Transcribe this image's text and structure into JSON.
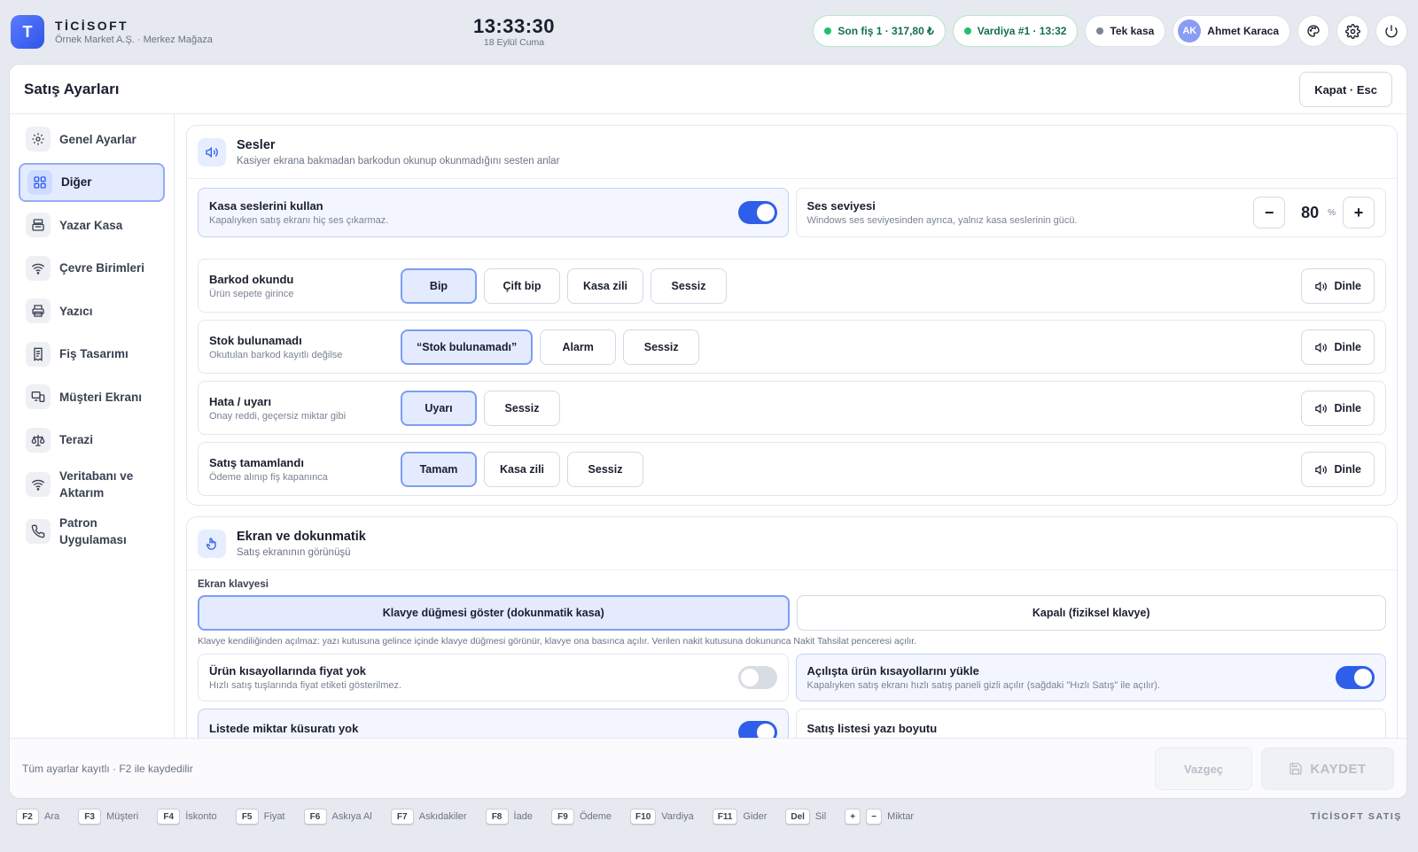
{
  "app": {
    "name": "TİCİSOFT",
    "company": "Örnek Market A.Ş. · Merkez Mağaza",
    "logo_letter": "T"
  },
  "clock": {
    "time": "13:33:30",
    "date": "18 Eylül Cuma"
  },
  "status": {
    "last_receipt": "Son fiş 1 · 317,80 ₺",
    "shift": "Vardiya #1 · 13:32",
    "register": "Tek kasa"
  },
  "user": {
    "initials": "AK",
    "name": "Ahmet Karaca"
  },
  "modal": {
    "title": "Satış Ayarları",
    "close_label": "Kapat · Esc"
  },
  "sidebar": {
    "items": [
      {
        "label": "Genel Ayarlar",
        "icon": "gear-icon"
      },
      {
        "label": "Diğer",
        "icon": "grid-icon",
        "active": true
      },
      {
        "label": "Yazar Kasa",
        "icon": "cash-register-icon"
      },
      {
        "label": "Çevre Birimleri",
        "icon": "wifi-icon"
      },
      {
        "label": "Yazıcı",
        "icon": "printer-icon"
      },
      {
        "label": "Fiş Tasarımı",
        "icon": "receipt-icon"
      },
      {
        "label": "Müşteri Ekranı",
        "icon": "monitor-icon"
      },
      {
        "label": "Terazi",
        "icon": "scale-icon"
      },
      {
        "label": "Veritabanı ve Aktarım",
        "icon": "wifi-icon"
      },
      {
        "label": "Patron Uygulaması",
        "icon": "phone-icon"
      }
    ]
  },
  "sounds": {
    "title": "Sesler",
    "subtitle": "Kasiyer ekrana bakmadan barkodun okunup okunmadığını sesten anlar",
    "use_sounds": {
      "label": "Kasa seslerini kullan",
      "desc": "Kapalıyken satış ekranı hiç ses çıkarmaz.",
      "on": true
    },
    "volume": {
      "label": "Ses seviyesi",
      "desc": "Windows ses seviyesinden ayrıca, yalnız kasa seslerinin gücü.",
      "value": "80",
      "unit": "%",
      "minus": "−",
      "plus": "+"
    },
    "listen_label": "Dinle",
    "events": [
      {
        "label": "Barkod okundu",
        "desc": "Ürün sepete girince",
        "options": [
          "Bip",
          "Çift bip",
          "Kasa zili",
          "Sessiz"
        ],
        "selected": 0
      },
      {
        "label": "Stok bulunamadı",
        "desc": "Okutulan barkod kayıtlı değilse",
        "options": [
          "“Stok bulunamadı”",
          "Alarm",
          "Sessiz"
        ],
        "selected": 0
      },
      {
        "label": "Hata / uyarı",
        "desc": "Onay reddi, geçersiz miktar gibi",
        "options": [
          "Uyarı",
          "Sessiz"
        ],
        "selected": 0
      },
      {
        "label": "Satış tamamlandı",
        "desc": "Ödeme alınıp fiş kapanınca",
        "options": [
          "Tamam",
          "Kasa zili",
          "Sessiz"
        ],
        "selected": 0
      }
    ]
  },
  "screen": {
    "title": "Ekran ve dokunmatik",
    "subtitle": "Satış ekranının görünüşü",
    "keyboard_section": "Ekran klavyesi",
    "keyboard_options": [
      "Klavye düğmesi göster (dokunmatik kasa)",
      "Kapalı (fiziksel klavye)"
    ],
    "keyboard_selected": 0,
    "keyboard_hint": "Klavye kendiliğinden açılmaz: yazı kutusuna gelince içinde klavye düğmesi görünür, klavye ona basınca açılır. Verilen nakit kutusuna dokununca Nakit Tahsilat penceresi açılır.",
    "no_price": {
      "label": "Ürün kısayollarında fiyat yok",
      "desc": "Hızlı satış tuşlarında fiyat etiketi gösterilmez.",
      "on": false
    },
    "load_shortcuts": {
      "label": "Açılışta ürün kısayollarını yükle",
      "desc": "Kapalıyken satış ekranı hızlı satış paneli gizli açılır (sağdaki \"Hızlı Satış\" ile açılır).",
      "on": true
    },
    "no_fraction": {
      "label": "Listede miktar küsuratı yok",
      "on": true
    },
    "font_size": {
      "label": "Satış listesi yazı boyutu"
    }
  },
  "footer": {
    "status": "Tüm ayarlar kayıtlı · F2 ile kaydedilir",
    "cancel": "Vazgeç",
    "save": "KAYDET"
  },
  "shortcuts": [
    {
      "key": "F2",
      "label": "Ara"
    },
    {
      "key": "F3",
      "label": "Müşteri"
    },
    {
      "key": "F4",
      "label": "İskonto"
    },
    {
      "key": "F5",
      "label": "Fiyat"
    },
    {
      "key": "F6",
      "label": "Askıya Al"
    },
    {
      "key": "F7",
      "label": "Askıdakiler"
    },
    {
      "key": "F8",
      "label": "İade"
    },
    {
      "key": "F9",
      "label": "Ödeme"
    },
    {
      "key": "F10",
      "label": "Vardiya"
    },
    {
      "key": "F11",
      "label": "Gider"
    },
    {
      "key": "Del",
      "label": "Sil"
    }
  ],
  "qty_shortcut": {
    "plus": "+",
    "minus": "−",
    "label": "Miktar"
  },
  "brand_footer": "TİCİSOFT SATIŞ",
  "colors": {
    "accent": "#2f5fe8",
    "selected_bg": "#e4ebff",
    "online": "#22c06b"
  }
}
